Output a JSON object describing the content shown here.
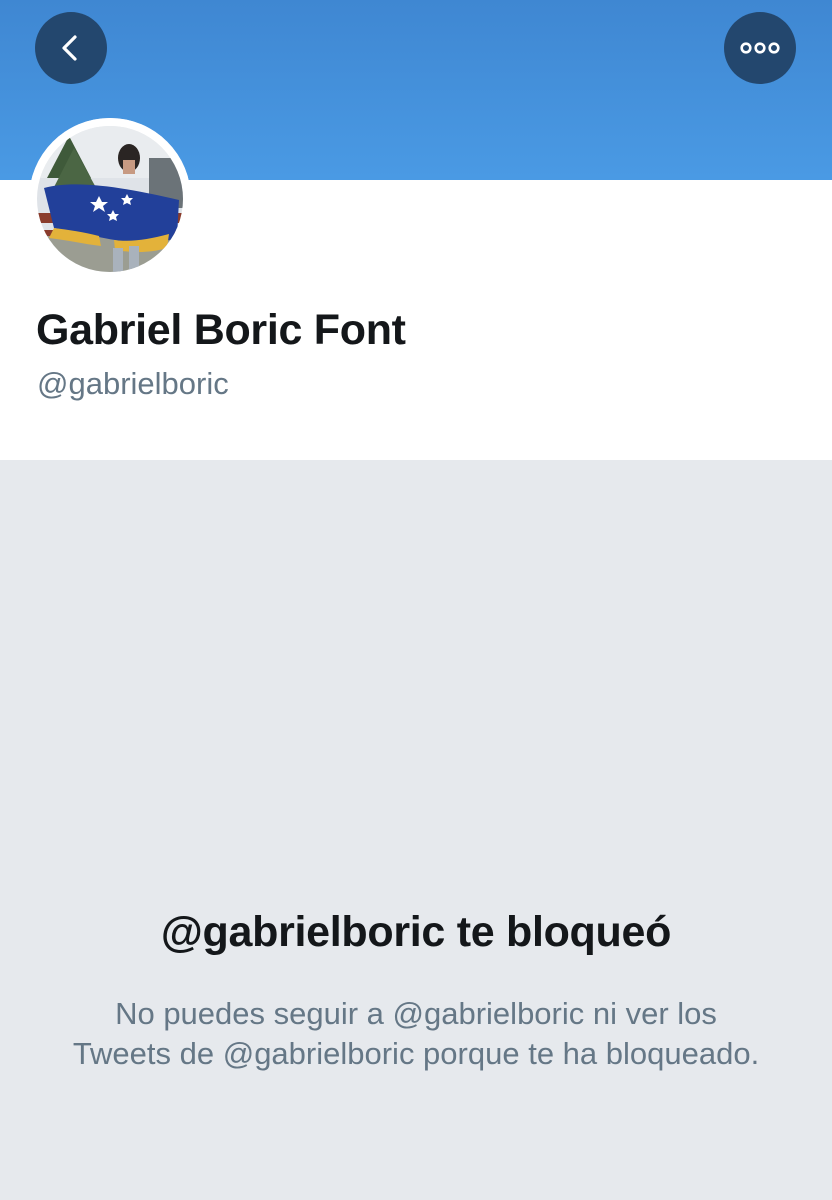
{
  "header": {
    "back_icon": "chevron-left-icon",
    "more_icon": "more-options-icon",
    "banner_color": "#4a9ae4",
    "button_color": "#23476e"
  },
  "profile": {
    "display_name": "Gabriel Boric Font",
    "handle": "@gabrielboric"
  },
  "blocked": {
    "title": "@gabrielboric te bloqueó",
    "message": "No puedes seguir a @gabrielboric ni ver los Tweets de @gabrielboric porque te ha bloqueado."
  }
}
